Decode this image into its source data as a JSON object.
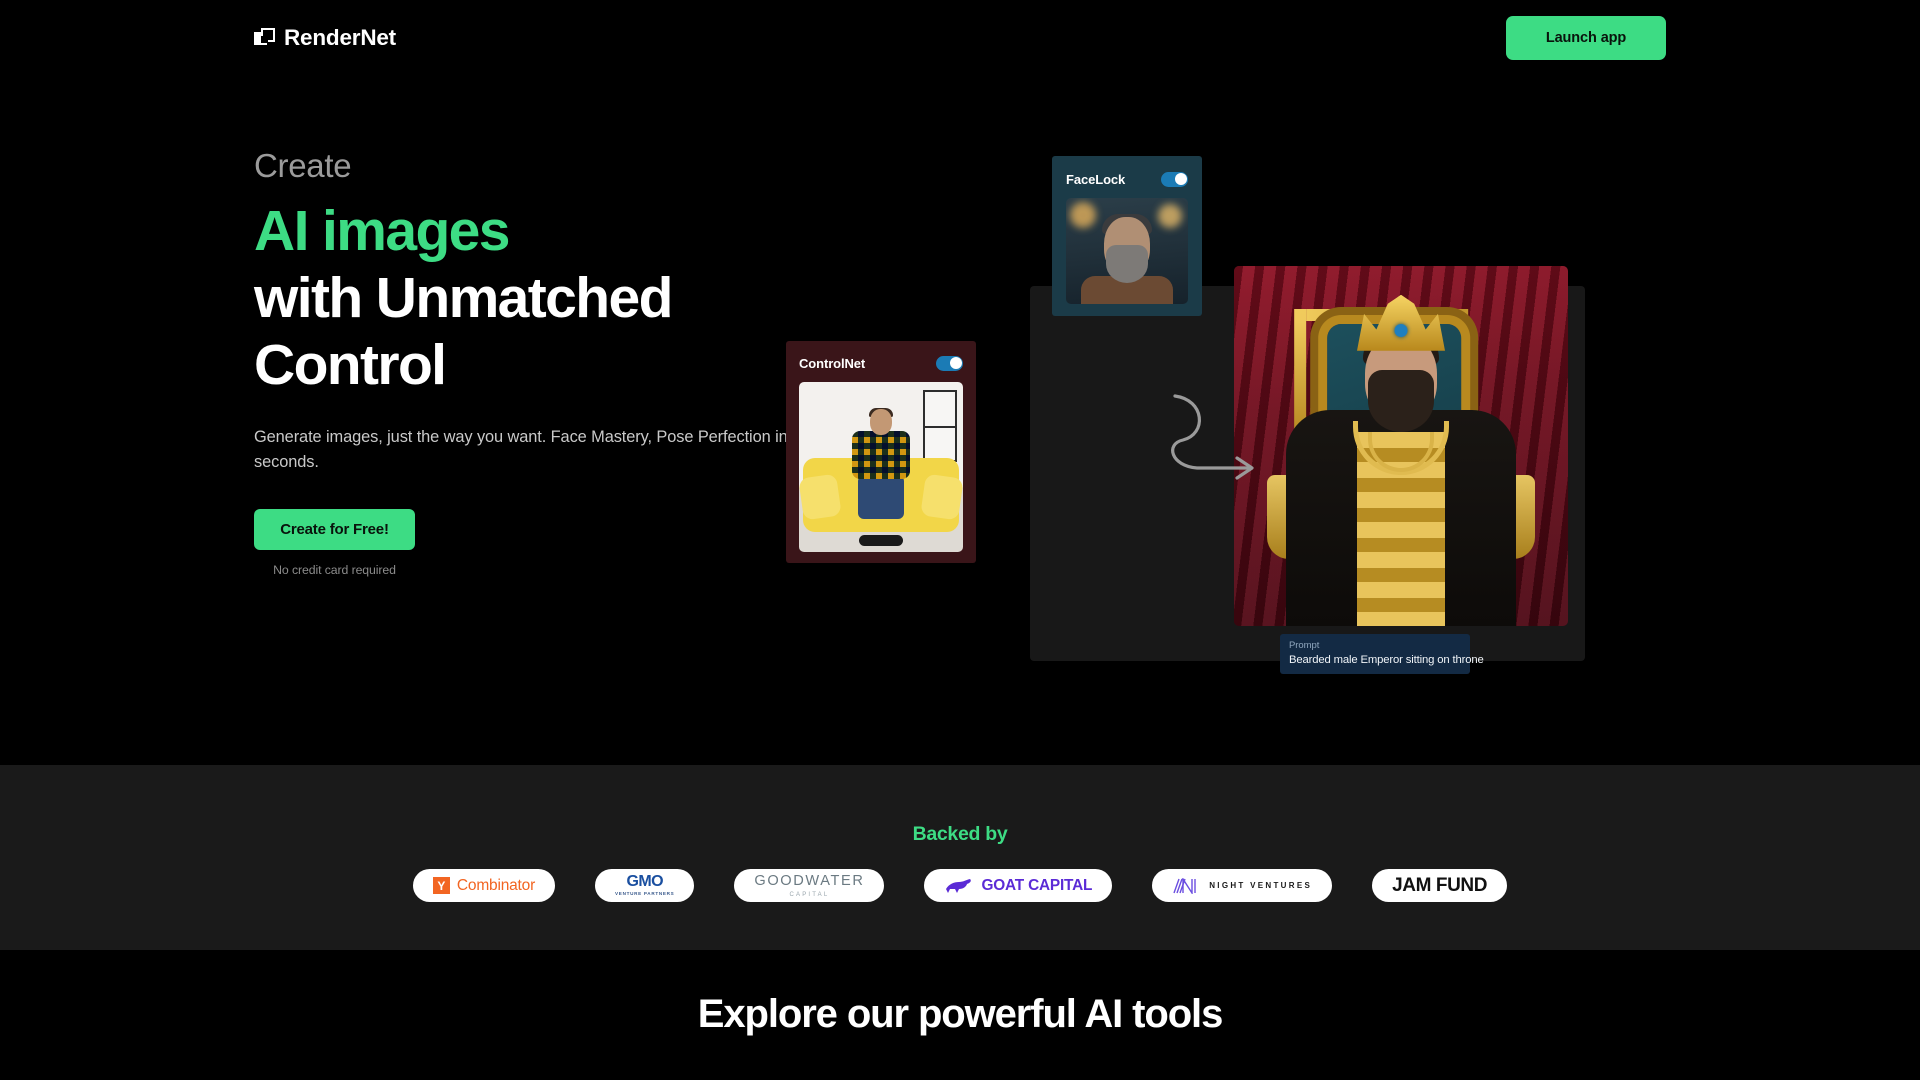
{
  "header": {
    "brand": "RenderNet",
    "logo_icon": "overlapping-squares-icon",
    "launch_label": "Launch app"
  },
  "hero": {
    "eyebrow": "Create",
    "headline_accent": "AI images",
    "headline_line2": "with Unmatched",
    "headline_line3": "Control",
    "subcopy": "Generate images, just the way you want. Face Mastery, Pose Perfection in seconds.",
    "cta_label": "Create for Free!",
    "cta_note": "No credit card required"
  },
  "visual": {
    "facelock": {
      "title": "FaceLock",
      "toggle_state": "on"
    },
    "controlnet": {
      "title": "ControlNet",
      "toggle_state": "on"
    },
    "prompt": {
      "label": "Prompt",
      "value": "Bearded male Emperor sitting on throne"
    },
    "arrow_icon": "curved-arrow-icon"
  },
  "backed": {
    "title": "Backed by",
    "logos": [
      {
        "name": "Y Combinator",
        "mark": "Y",
        "text": "Combinator",
        "color": "#f26522"
      },
      {
        "name": "GMO Venture Partners",
        "main": "GMO",
        "sub": "VENTURE PARTNERS",
        "color": "#1a4fa0"
      },
      {
        "name": "Goodwater Capital",
        "main": "GOODWATER",
        "sub": "CAPITAL",
        "color": "#6b7a82"
      },
      {
        "name": "Goat Capital",
        "text": "GOAT CAPITAL",
        "icon": "goat-icon",
        "color": "#5b2bd6"
      },
      {
        "name": "Night Ventures",
        "text": "NIGHT VENTURES",
        "icon": "night-ventures-icon",
        "color": "#5b2bd6"
      },
      {
        "name": "Jam Fund",
        "text": "JAM FUND",
        "color": "#111111"
      }
    ]
  },
  "tools": {
    "title": "Explore our powerful AI tools"
  },
  "theme": {
    "accent_green": "#3ddc84",
    "page_bg": "#000000",
    "band_bg": "#1a1a1a"
  }
}
